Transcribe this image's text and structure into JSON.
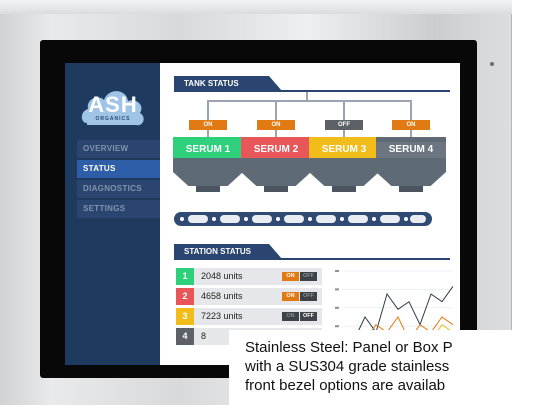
{
  "logo": {
    "text": "ASH",
    "sub": "ORGANICS"
  },
  "sidebar": {
    "items": [
      {
        "label": "OVERVIEW",
        "active": false
      },
      {
        "label": "STATUS",
        "active": true
      },
      {
        "label": "DIAGNOSTICS",
        "active": false
      },
      {
        "label": "SETTINGS",
        "active": false
      }
    ]
  },
  "tank_status": {
    "title": "TANK STATUS",
    "tanks": [
      {
        "name": "SERUM 1",
        "state": "ON",
        "color": "#2fd07c"
      },
      {
        "name": "SERUM 2",
        "state": "ON",
        "color": "#e8565a"
      },
      {
        "name": "SERUM 3",
        "state": "OFF",
        "color": "#f2bc1b"
      },
      {
        "name": "SERUM 4",
        "state": "ON",
        "color": "#6b7680"
      }
    ]
  },
  "station_status": {
    "title": "STATION STATUS",
    "rows": [
      {
        "num": "1",
        "units": "2048 units",
        "on_label": "ON",
        "off_label": "OFF",
        "state": "on",
        "color": "#2fd07c"
      },
      {
        "num": "2",
        "units": "4658 units",
        "on_label": "ON",
        "off_label": "OFF",
        "state": "on",
        "color": "#e8565a"
      },
      {
        "num": "3",
        "units": "7223 units",
        "on_label": "ON",
        "off_label": "OFF",
        "state": "off",
        "color": "#f2bc1b"
      },
      {
        "num": "4",
        "units": "8",
        "on_label": "",
        "off_label": "",
        "state": "on",
        "color": "#5c6167"
      }
    ]
  },
  "chart_data": {
    "type": "line",
    "x": [
      0,
      1,
      2,
      3,
      4,
      5,
      6,
      7,
      8,
      9,
      10
    ],
    "series": [
      {
        "values": [
          2,
          3,
          6,
          4,
          9,
          7,
          8,
          5,
          9,
          8,
          10
        ],
        "color": "#2f3b48"
      },
      {
        "values": [
          1,
          2,
          3,
          5,
          4,
          6,
          3,
          5,
          4,
          6,
          5
        ],
        "color": "#e27a13"
      },
      {
        "values": [
          0,
          1,
          2,
          4,
          3,
          4,
          2,
          4,
          3,
          5,
          4
        ],
        "color": "#f2bc1b"
      },
      {
        "values": [
          0,
          1,
          1,
          3,
          2,
          3,
          1,
          3,
          2,
          4,
          3
        ],
        "color": "#e8565a"
      }
    ],
    "ylim": [
      0,
      12
    ]
  },
  "caption": {
    "line1": "Stainless Steel: Panel or Box P",
    "line2": "with a SUS304 grade stainless",
    "line3": "front bezel options are availab"
  }
}
